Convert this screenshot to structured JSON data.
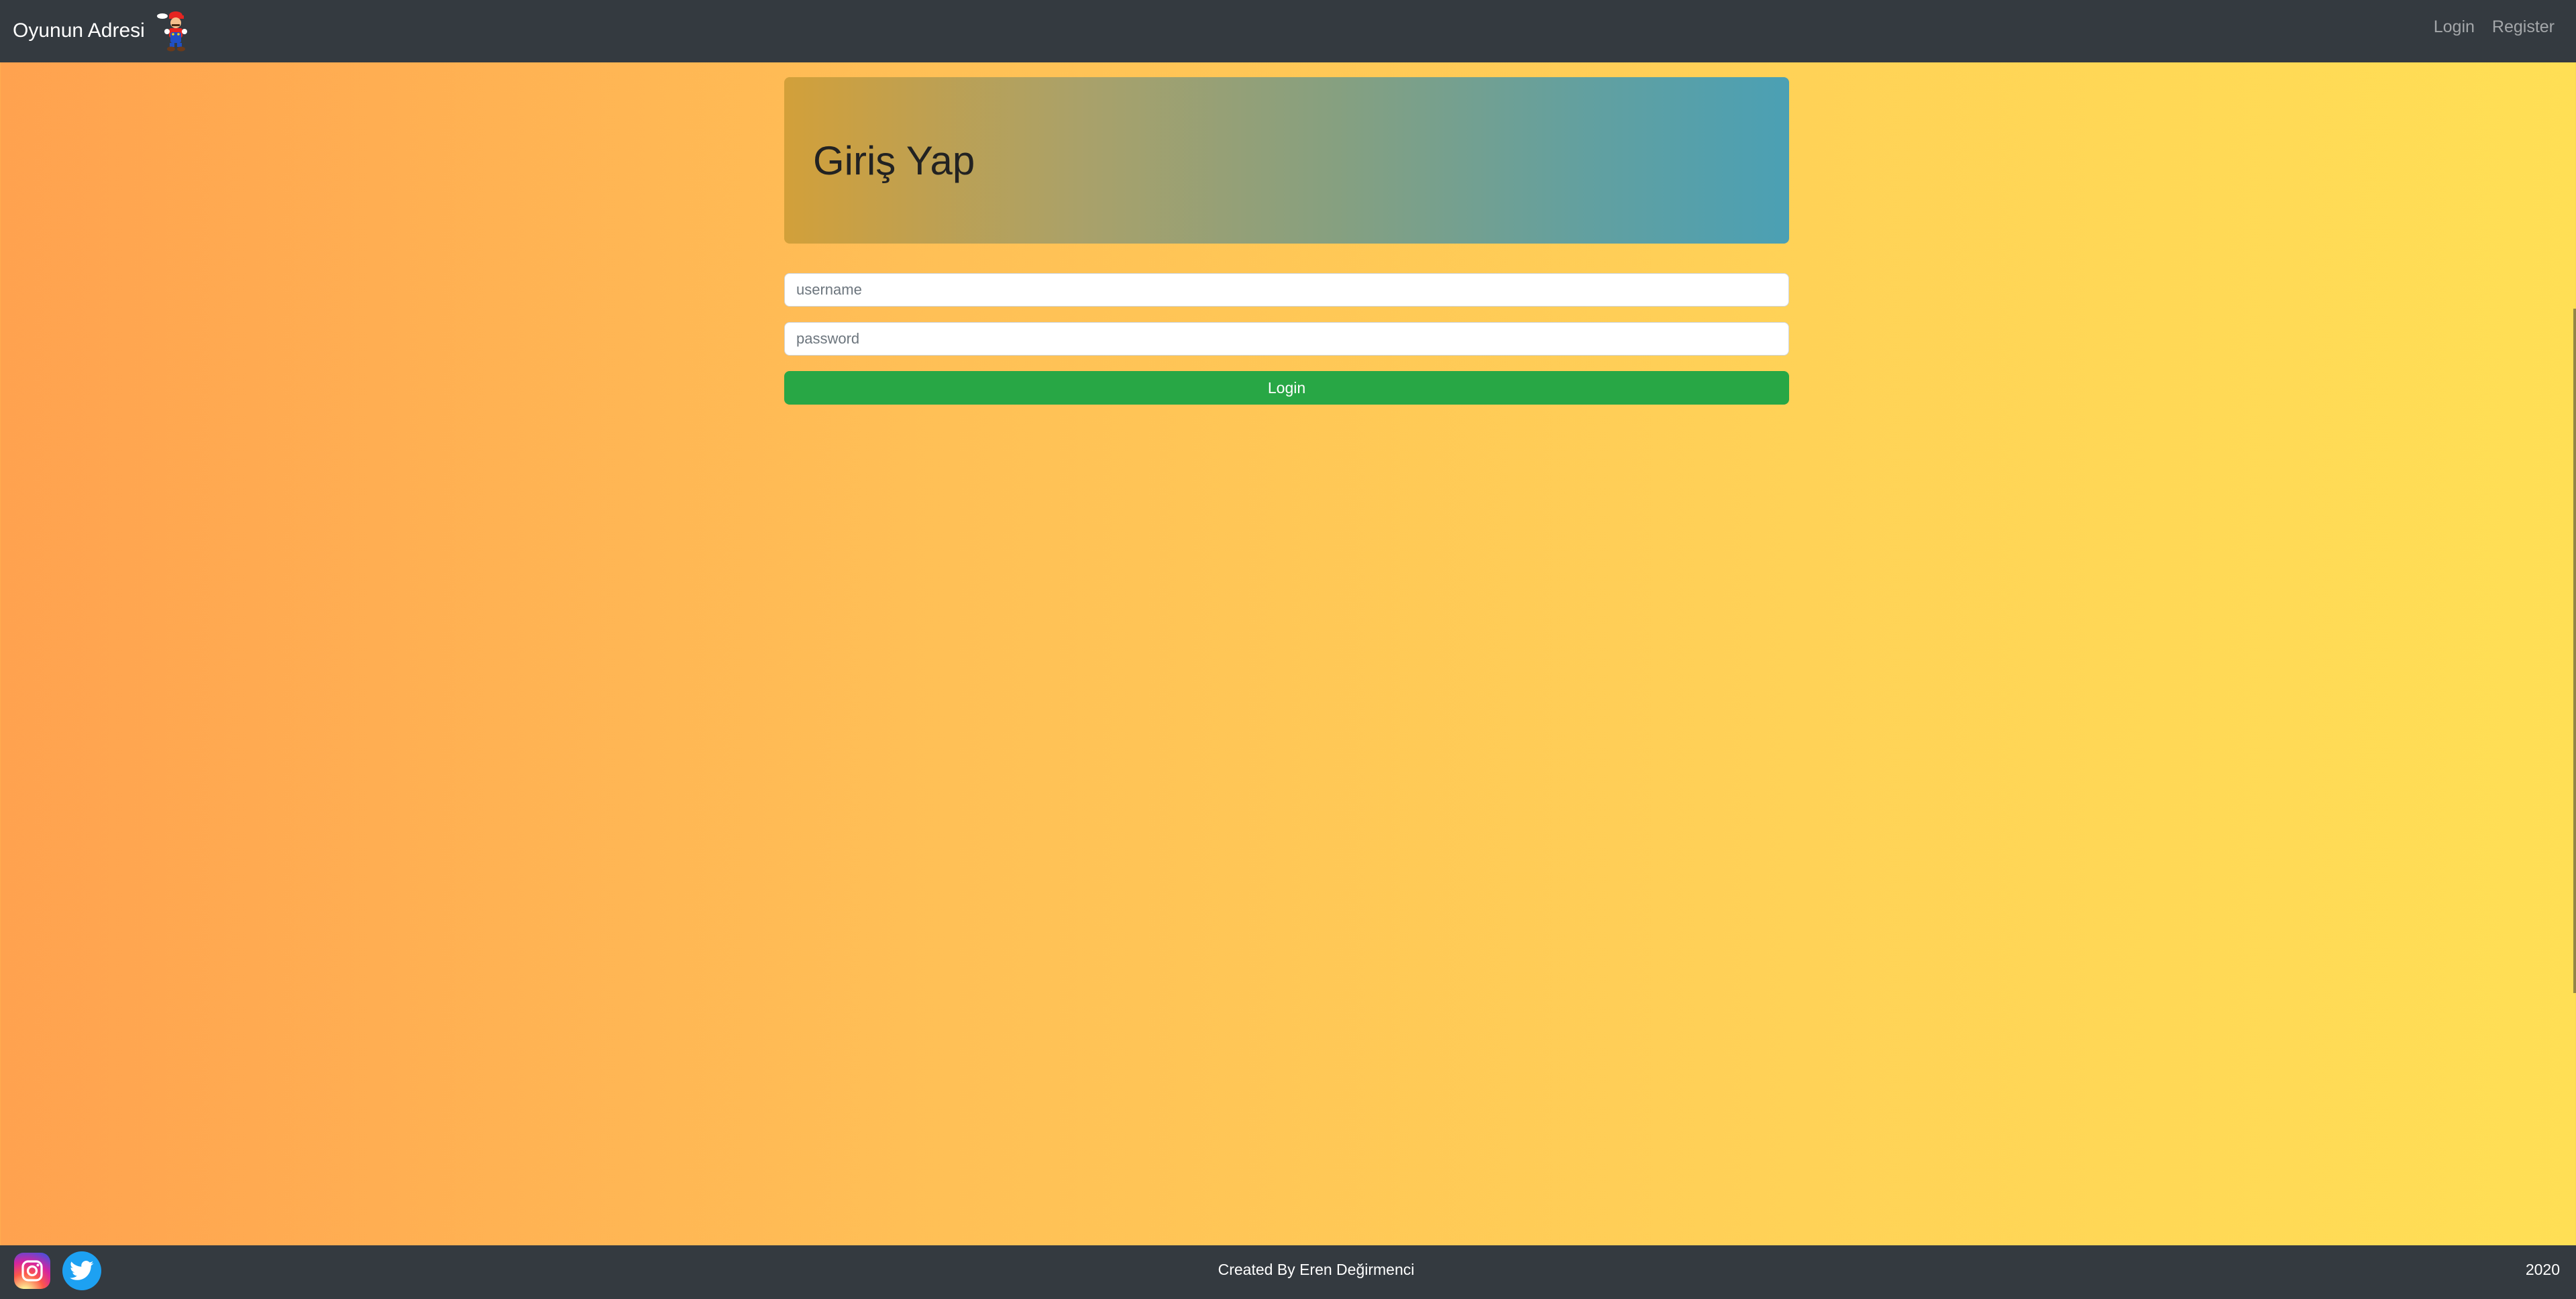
{
  "navbar": {
    "brand": "Oyunun Adresi",
    "links": [
      "Login",
      "Register"
    ]
  },
  "jumbotron": {
    "title": "Giriş Yap"
  },
  "form": {
    "username_placeholder": "username",
    "password_placeholder": "password",
    "login_label": "Login"
  },
  "footer": {
    "credit": "Created By Eren Değirmenci",
    "year": "2020",
    "social_icons": [
      "instagram-icon",
      "twitter-icon"
    ]
  },
  "colors": {
    "navbar": "#343a40",
    "login_button": "#28a745",
    "twitter": "#1da1f2"
  }
}
